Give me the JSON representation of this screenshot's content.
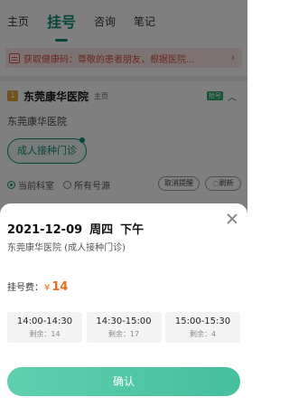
{
  "tabs": [
    {
      "label": "主页"
    },
    {
      "label": "挂号",
      "active": true
    },
    {
      "label": "咨询"
    },
    {
      "label": "笔记"
    }
  ],
  "notice": {
    "text": "获取健康码：尊敬的患者朋友，根据医院..."
  },
  "hospital": {
    "badge": "1",
    "name": "东莞康华医院",
    "home_label": "主页",
    "tag": "抢号",
    "subtitle": "东莞康华医院"
  },
  "clinic": {
    "label": "成人接种门诊"
  },
  "filters": {
    "current_dept": "当前科室",
    "all_available": "所有号源"
  },
  "chips": {
    "cancel_remind": "取消提醒",
    "refresh": "刷新"
  },
  "sheet": {
    "date": "2021-12-09",
    "weekday": "周四",
    "period": "下午",
    "hospital_clinic": "东莞康华医院 (成人接种门诊)",
    "fee_label": "挂号费：",
    "fee_symbol": "¥",
    "fee_value": "14",
    "slots": [
      {
        "time": "14:00-14:30",
        "remaining": "剩余：14"
      },
      {
        "time": "14:30-15:00",
        "remaining": "剩余：17"
      },
      {
        "time": "15:00-15:30",
        "remaining": "剩余：4"
      }
    ],
    "confirm_label": "确认"
  },
  "colors": {
    "accent": "#0c8f72",
    "fee": "#ef6c1a",
    "notice": "#d4513d",
    "button": "#4fc6a4"
  }
}
